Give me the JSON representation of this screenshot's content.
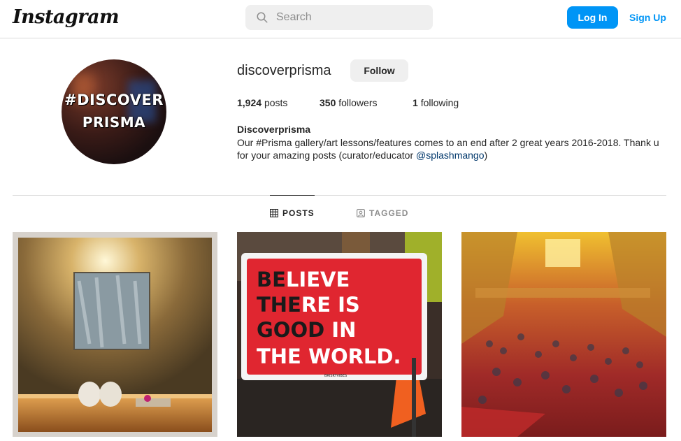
{
  "header": {
    "logo_text": "Instagram",
    "search_placeholder": "Search",
    "login_label": "Log In",
    "signup_label": "Sign Up"
  },
  "profile": {
    "avatar_text_line1": "#DISCOVER",
    "avatar_text_line2": "PRISMA",
    "username": "discoverprisma",
    "follow_label": "Follow",
    "posts_count": "1,924",
    "posts_label": "posts",
    "followers_count": "350",
    "followers_label": "followers",
    "following_count": "1",
    "following_label": "following",
    "full_name": "Discoverprisma",
    "bio_text": "Our #Prisma gallery/art lessons/features comes to an end after 2 great years 2016-2018. Thank u for your amazing posts (curator/educator ",
    "bio_link": "@splashmango",
    "bio_end": ")"
  },
  "tabs": [
    {
      "label": "POSTS",
      "icon": "grid-icon",
      "active": true
    },
    {
      "label": "TAGGED",
      "icon": "tagged-icon",
      "active": false
    }
  ],
  "posts": [
    {
      "alt": "towels-under-painting"
    },
    {
      "sign_lines": [
        "BELIEVE",
        "THERE IS",
        "GOOD IN",
        "THE WORLD."
      ],
      "sign_credit": "BRISKTVIBES"
    },
    {
      "alt": "crowd-in-ornate-hall"
    }
  ],
  "colors": {
    "accent": "#0095f6",
    "link": "#00376b",
    "text": "#262626",
    "muted": "#8e8e8e",
    "border": "#dbdbdb"
  }
}
